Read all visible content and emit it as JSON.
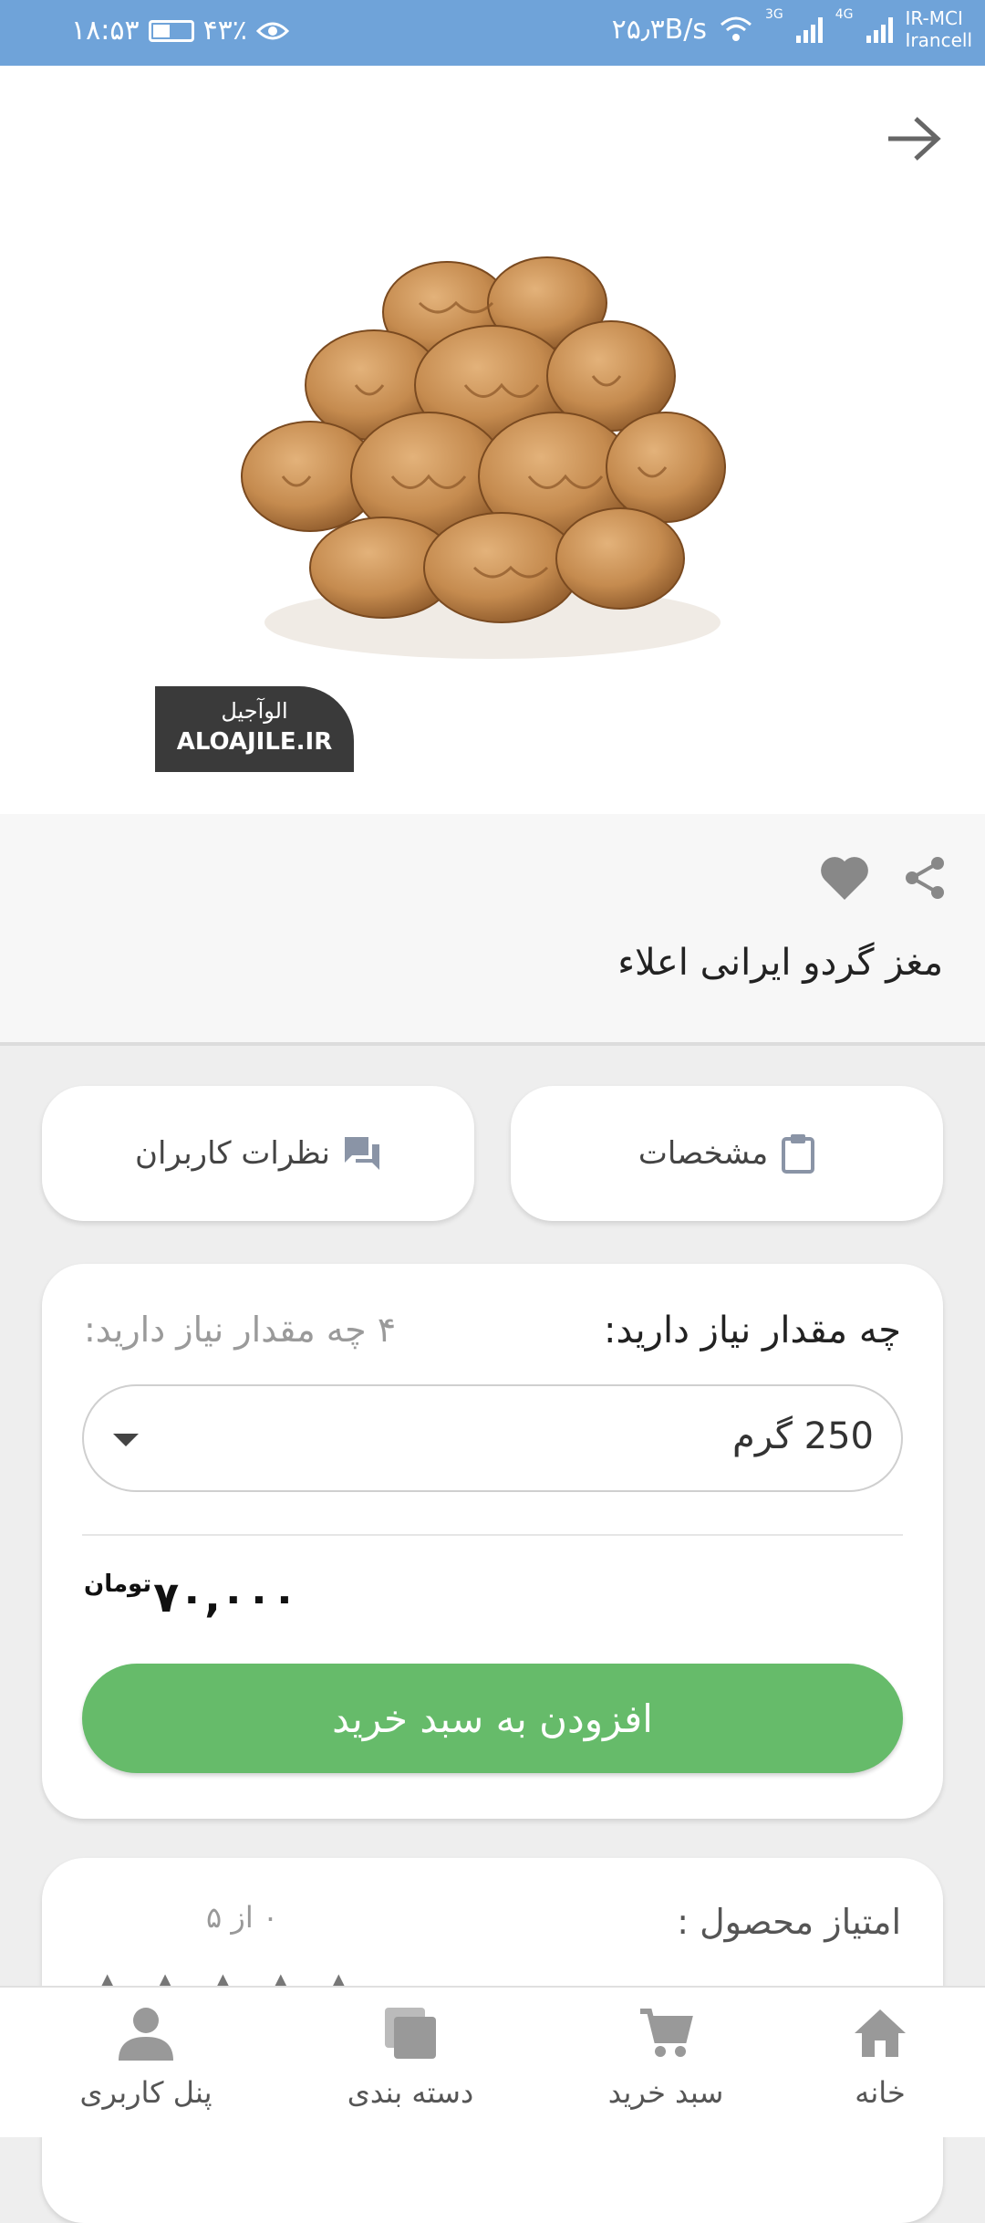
{
  "status_bar": {
    "time": "۱۸:۵۳",
    "battery": "۴۳٪",
    "network_speed": "۲۵٫۳B/s",
    "net_3g": "3G",
    "net_4g": "4G",
    "carrier_1": "IR-MCI",
    "carrier_2": "Irancell"
  },
  "hero": {
    "watermark_fa": "الوآجیل",
    "watermark_en": "ALOAJILE.IR"
  },
  "product": {
    "title": "مغز گردو ایرانی اعلاء"
  },
  "tabs": {
    "specs_label": "مشخصات",
    "reviews_label": "نظرات کاربران"
  },
  "purchase": {
    "quantity_label": "چه مقدار نیاز دارید:",
    "quantity_hint": "۴ چه مقدار نیاز دارید:",
    "selected_option": "250 گرم",
    "price": "۷۰,۰۰۰",
    "currency": "تومان",
    "add_to_cart": "افزودن به سبد خرید"
  },
  "rating": {
    "label": "امتیاز محصول :",
    "score": "۰ از ۵"
  },
  "bottom_nav": {
    "home": "خانه",
    "cart": "سبد خرید",
    "categories": "دسته بندی",
    "user_panel": "پنل کاربری"
  },
  "colors": {
    "status_bar": "#6fa3d9",
    "add_button": "#66bb6a"
  }
}
